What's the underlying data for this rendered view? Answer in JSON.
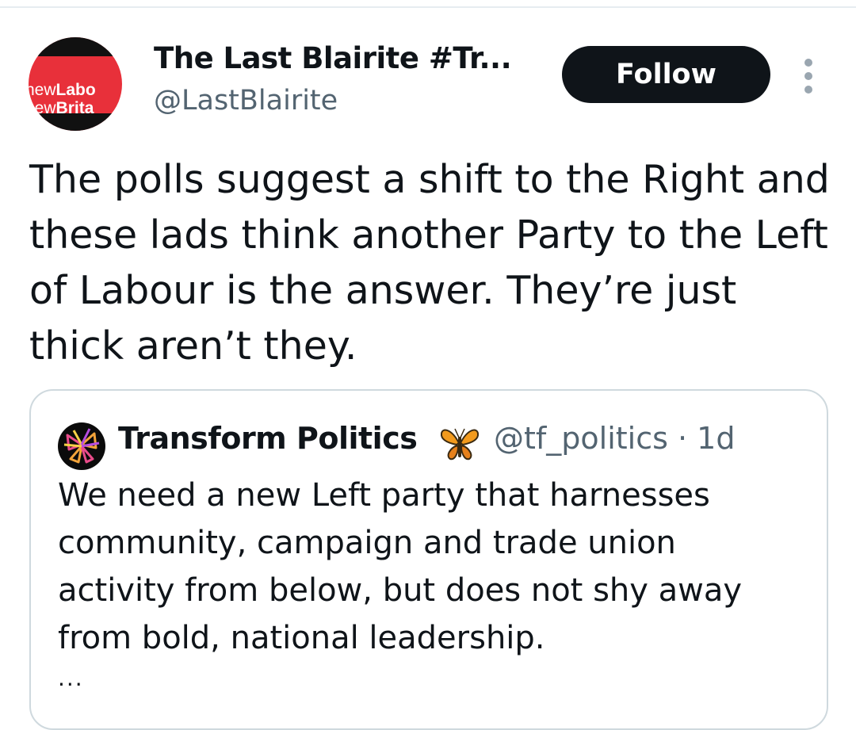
{
  "author": {
    "name": "The Last Blairite #Tr...",
    "handle": "@LastBlairite",
    "avatar_logo": {
      "line1_prefix": "new",
      "line1_bold": "Labo",
      "line2_prefix": "new",
      "line2_bold": "Brita"
    }
  },
  "actions": {
    "follow_label": "Follow",
    "more_icon": "more-vertical-icon"
  },
  "tweet": {
    "text": "The polls suggest a shift to the Right and these lads think another Party to the Left of Labour is the answer. They’re just thick aren’t they."
  },
  "quote": {
    "name": "Transform Politics",
    "emoji_icon": "butterfly-icon",
    "meta": "@tf_politics · 1d",
    "text": "We need a new Left party that harnesses community, campaign and trade union activity from below, but does not shy away from bold, national leadership.",
    "more": "..."
  },
  "colors": {
    "text_primary": "#0f1419",
    "text_secondary": "#536471",
    "follow_bg": "#0f1419",
    "border": "#cfd9de",
    "avatar_red": "#e8303a"
  }
}
